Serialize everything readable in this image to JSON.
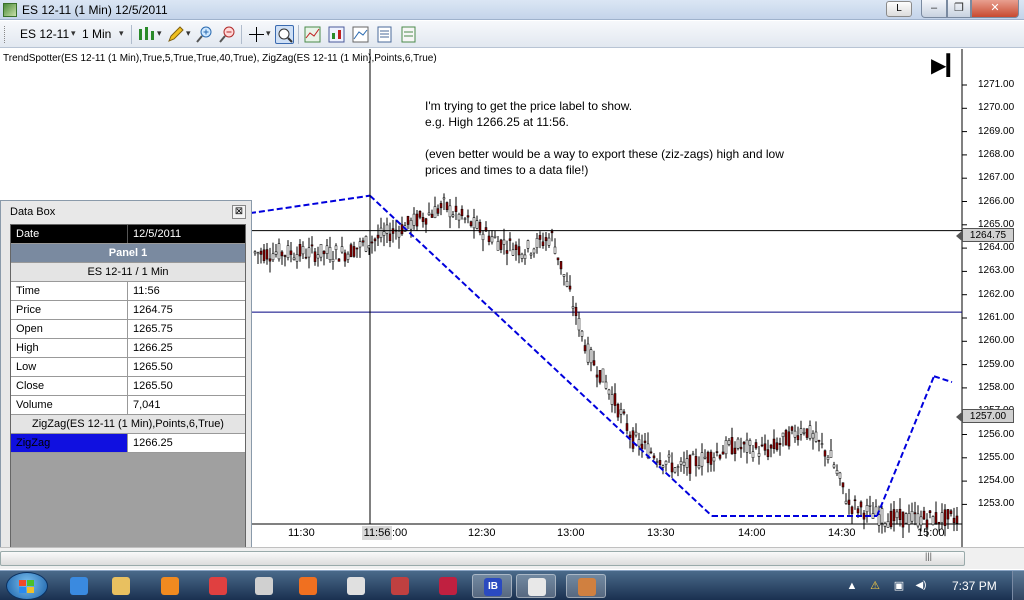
{
  "window": {
    "title": "ES 12-11 (1 Min)  12/5/2011",
    "l_button": "L",
    "min_glyph": "–",
    "max_glyph": "❐",
    "close_glyph": "✕"
  },
  "toolbar": {
    "instrument": "ES 12-11",
    "interval": "1 Min",
    "caret": "▾",
    "icons": [
      "bar-style-icon",
      "pencil-icon",
      "zoom-in-icon",
      "zoom-out-icon",
      "crosshair-icon",
      "magnify-icon",
      "indicators-icon",
      "strategies-icon",
      "chart-properties-icon",
      "data-box-icon"
    ]
  },
  "chart": {
    "indicator_label": "TrendSpotter(ES 12-11 (1 Min),True,5,True,True,40,True), ZigZag(ES 12-11 (1 Min),Points,6,True)",
    "note_lines": [
      "I'm trying to get the price label to show.",
      "e.g. High 1266.25 at 11:56.",
      "",
      "(even better would be a way to export these (ziz-zags) high and low",
      "prices and times to a data file!)"
    ],
    "skip_end_glyph": "▶▎",
    "y_ticks": [
      "1271.00",
      "1270.00",
      "1269.00",
      "1268.00",
      "1267.00",
      "1266.00",
      "1265.00",
      "1264.00",
      "1263.00",
      "1262.00",
      "1261.00",
      "1260.00",
      "1259.00",
      "1258.00",
      "1257.00",
      "1256.00",
      "1255.00",
      "1254.00",
      "1253.00"
    ],
    "x_ticks": [
      "11:30",
      ":00",
      "12:30",
      "13:00",
      "13:30",
      "14:00",
      "14:30",
      "15:00"
    ],
    "cursor_time": "11:56",
    "crosshair_price_tag": "1264.75",
    "last_price_tag": "1257.00",
    "colors": {
      "zigzag": "#0000dd",
      "crosshair": "#000000",
      "level": "#000080",
      "candle_down": "#8b0000"
    }
  },
  "chart_data": {
    "type": "candlestick",
    "x_unit": "time",
    "y_unit": "price",
    "ylim": [
      1252.5,
      1271.5
    ],
    "crosshair": {
      "time": "11:56",
      "price": 1264.75
    },
    "horizontal_level": 1261.25,
    "zigzag": [
      {
        "time": "10:40",
        "price": 1265.5
      },
      {
        "time": "11:56",
        "price": 1266.25
      },
      {
        "time": "13:50",
        "price": 1252.5
      },
      {
        "time": "14:45",
        "price": 1252.5
      },
      {
        "time": "15:04",
        "price": 1258.5
      },
      {
        "time": "15:10",
        "price": 1258.25
      }
    ]
  },
  "databox": {
    "title": "Data Box",
    "close_glyph": "⊠",
    "date_label": "Date",
    "date_value": "12/5/2011",
    "panel_label": "Panel 1",
    "instrument_label": "ES 12-11 / 1 Min",
    "rows": [
      {
        "k": "Time",
        "v": "11:56"
      },
      {
        "k": "Price",
        "v": "1264.75"
      },
      {
        "k": "Open",
        "v": "1265.75"
      },
      {
        "k": "High",
        "v": "1266.25"
      },
      {
        "k": "Low",
        "v": "1265.50"
      },
      {
        "k": "Close",
        "v": "1265.50"
      },
      {
        "k": "Volume",
        "v": "7,041"
      }
    ],
    "zigzag_label": "ZigZag(ES 12-11 (1 Min),Points,6,True)",
    "zigzag_key": "ZigZag",
    "zigzag_value": "1266.25"
  },
  "scrollbar": {
    "grip": "|||"
  },
  "taskbar": {
    "icons": [
      "ie-icon",
      "explorer-icon",
      "media-player-icon",
      "pin-icon",
      "chrome-icon",
      "firefox-icon",
      "app-icon",
      "paint-icon",
      "ninja-icon",
      "ib-icon",
      "notepad-icon",
      "chart-app-icon"
    ],
    "ib_text": "IB",
    "clock": "7:37 PM",
    "tray": [
      "▲",
      "⚠",
      "▣",
      "◀)"
    ]
  }
}
